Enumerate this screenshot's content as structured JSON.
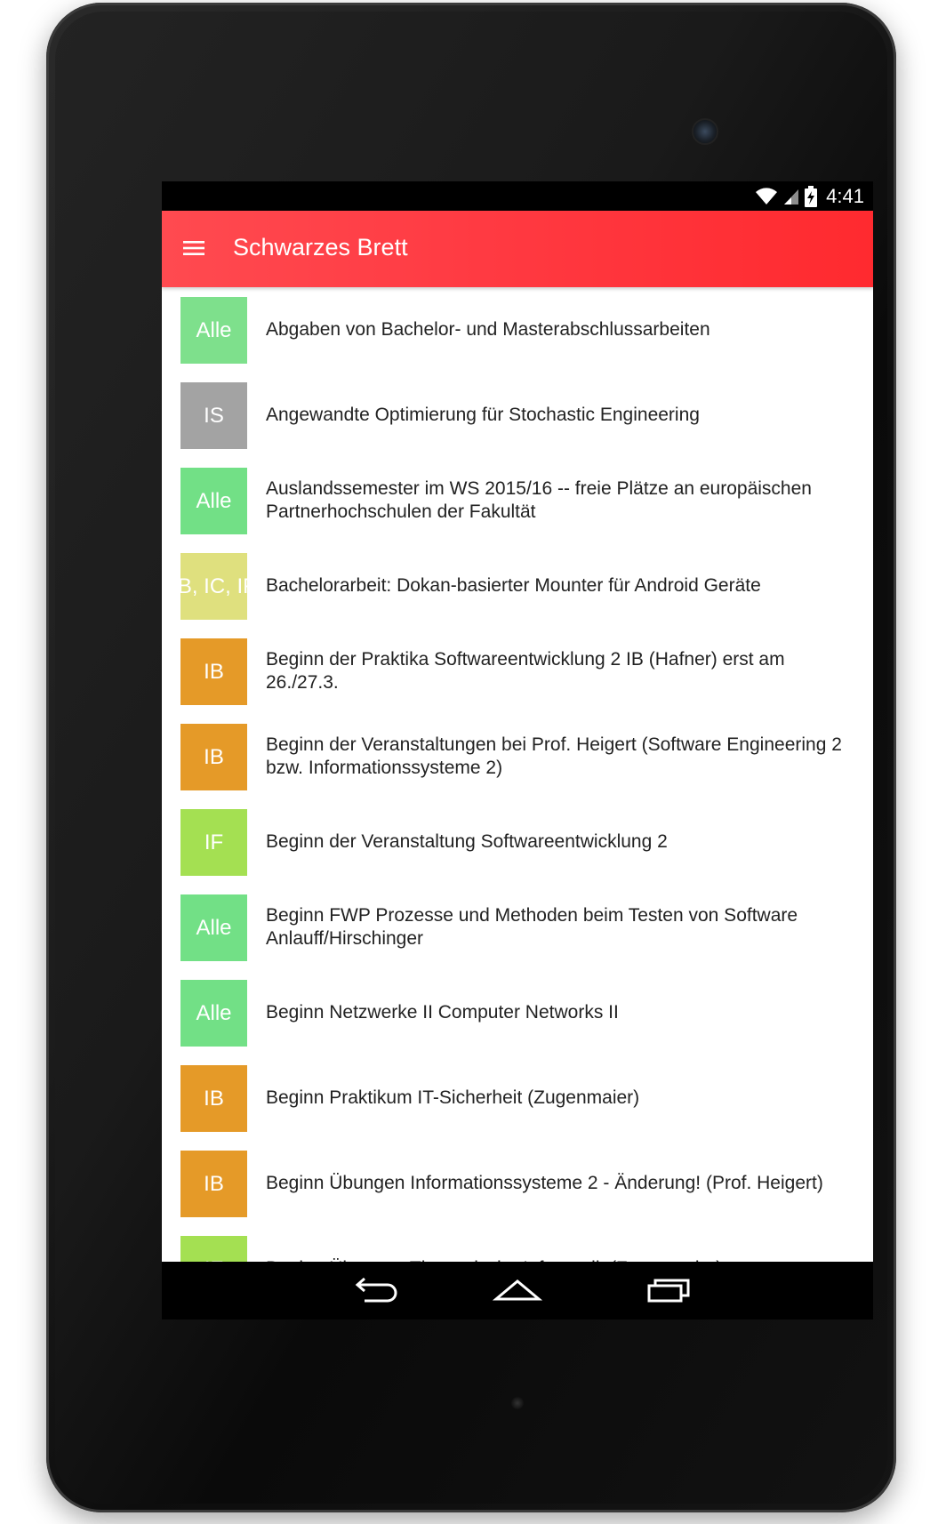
{
  "status_bar": {
    "time": "4:41",
    "icons": [
      "wifi-icon",
      "signal-icon",
      "battery-charging-icon"
    ]
  },
  "app_bar": {
    "title": "Schwarzes Brett",
    "menu_icon": "hamburger-menu-icon",
    "color": "#ff3a42"
  },
  "items": [
    {
      "badge": "Alle",
      "color": "#7ee08c",
      "title": "Abgaben von Bachelor- und Masterabschlussarbeiten"
    },
    {
      "badge": "IS",
      "color": "#a3a3a3",
      "title": "Angewandte Optimierung für Stochastic Engineering"
    },
    {
      "badge": "Alle",
      "color": "#72e086",
      "title": "Auslandssemester im WS 2015/16 -- freie Plätze an europäischen Partnerhochschulen der Fakultät"
    },
    {
      "badge": "IB, IC, IF",
      "color": "#dfe07e",
      "title": "Bachelorarbeit: Dokan-basierter Mounter für Android Geräte"
    },
    {
      "badge": "IB",
      "color": "#e59a28",
      "title": "Beginn der Praktika Softwareentwicklung 2 IB (Hafner) erst am 26./27.3."
    },
    {
      "badge": "IB",
      "color": "#e59a28",
      "title": "Beginn der Veranstaltungen bei Prof. Heigert (Software Engineering 2 bzw. Informationssysteme 2)"
    },
    {
      "badge": "IF",
      "color": "#a4e052",
      "title": "Beginn der Veranstaltung Softwareentwicklung 2"
    },
    {
      "badge": "Alle",
      "color": "#72e086",
      "title": "Beginn FWP Prozesse und Methoden beim Testen von Software Anlauff/Hirschinger"
    },
    {
      "badge": "Alle",
      "color": "#72e086",
      "title": "Beginn Netzwerke II Computer Networks II"
    },
    {
      "badge": "IB",
      "color": "#e59a28",
      "title": "Beginn Praktikum IT-Sicherheit (Zugenmaier)"
    },
    {
      "badge": "IB",
      "color": "#e59a28",
      "title": "Beginn Übungen Informationssysteme 2 - Änderung! (Prof. Heigert)"
    },
    {
      "badge": "IF",
      "color": "#a4e052",
      "title": "Beginn Übungen Theoretische Informatik (Zugenmaier)"
    }
  ],
  "nav_bar": {
    "buttons": [
      "back-icon",
      "home-icon",
      "recents-icon"
    ]
  }
}
